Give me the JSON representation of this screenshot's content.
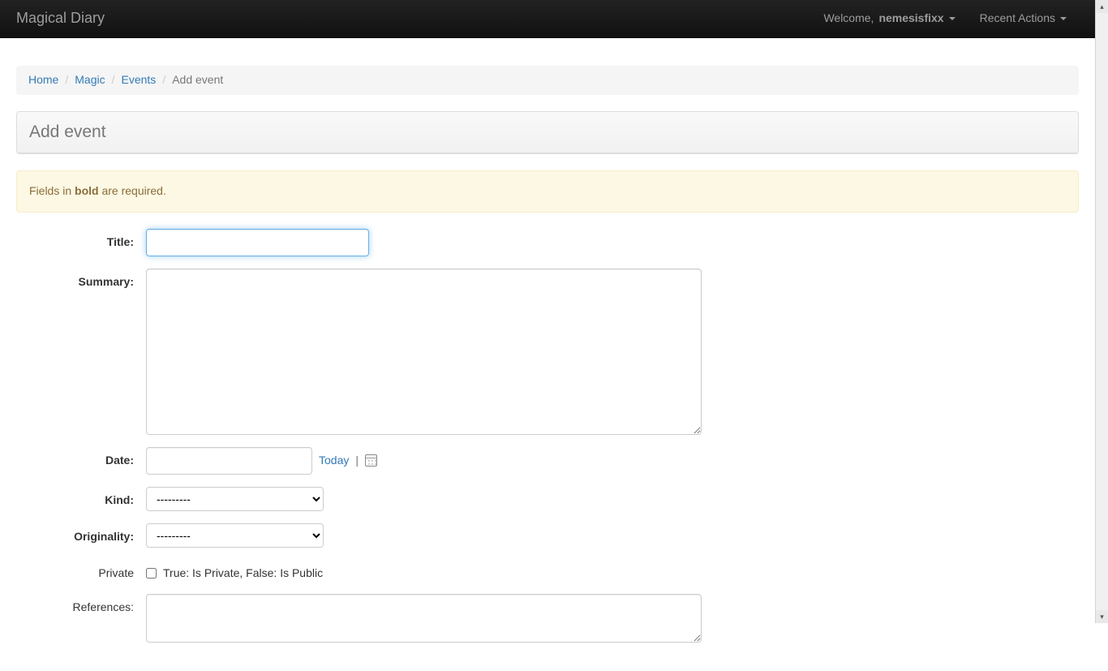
{
  "navbar": {
    "brand": "Magical Diary",
    "welcome_prefix": "Welcome, ",
    "username": "nemesisfixx",
    "recent_actions": "Recent Actions"
  },
  "breadcrumb": {
    "items": [
      {
        "label": "Home"
      },
      {
        "label": "Magic"
      },
      {
        "label": "Events"
      }
    ],
    "active": "Add event"
  },
  "page": {
    "title": "Add event"
  },
  "alert": {
    "prefix": "Fields in ",
    "bold": "bold",
    "suffix": " are required."
  },
  "form": {
    "title": {
      "label": "Title:",
      "value": ""
    },
    "summary": {
      "label": "Summary:",
      "value": ""
    },
    "date": {
      "label": "Date:",
      "value": "",
      "today_link": "Today",
      "separator": "|"
    },
    "kind": {
      "label": "Kind:",
      "selected": "---------"
    },
    "originality": {
      "label": "Originality:",
      "selected": "---------"
    },
    "private": {
      "label": "Private",
      "help": "True: Is Private, False: Is Public",
      "checked": false
    },
    "references": {
      "label": "References:",
      "value": ""
    }
  }
}
